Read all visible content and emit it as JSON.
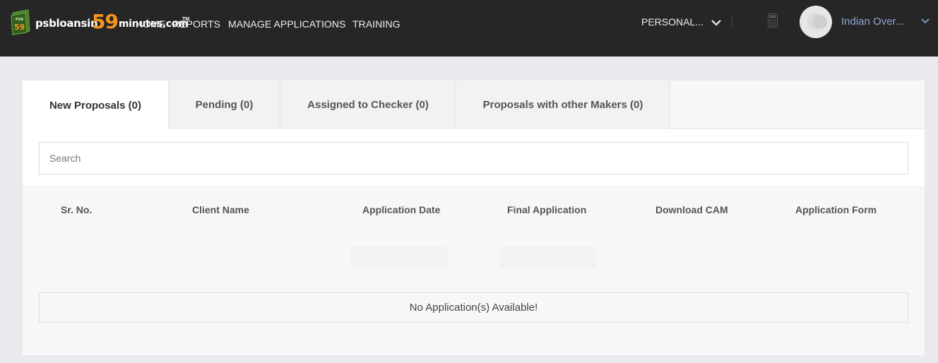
{
  "brand": {
    "badge_text": "PSB 59",
    "name_part1": "psbloansin",
    "name_number": "59",
    "name_part2": "minutes.com",
    "trademark": "TM"
  },
  "nav": {
    "items": [
      {
        "label": "HOME"
      },
      {
        "label": "REPORTS"
      },
      {
        "label": "MANAGE APPLICATIONS"
      },
      {
        "label": "TRAINING"
      }
    ],
    "persona_label": "PERSONAL...",
    "user_name": "Indian Over..."
  },
  "tabs": [
    {
      "label": "New Proposals (0)",
      "active": true
    },
    {
      "label": "Pending (0)",
      "active": false
    },
    {
      "label": "Assigned to Checker (0)",
      "active": false
    },
    {
      "label": "Proposals with other Makers (0)",
      "active": false
    }
  ],
  "search": {
    "placeholder": "Search",
    "value": ""
  },
  "table": {
    "columns": [
      "Sr. No.",
      "Client Name",
      "Application Date",
      "Final Application",
      "Download CAM",
      "Application Form"
    ],
    "empty_message": "No Application(s) Available!"
  },
  "colors": {
    "navbar_bg": "#262626",
    "brand_orange": "#f7941d",
    "user_name_color": "#8da4d6",
    "page_bg": "#e8eaed"
  },
  "icons": {
    "persona_dropdown": "chevron-down-icon",
    "calculator": "calculator-icon",
    "user_dropdown": "chevron-down-icon"
  }
}
